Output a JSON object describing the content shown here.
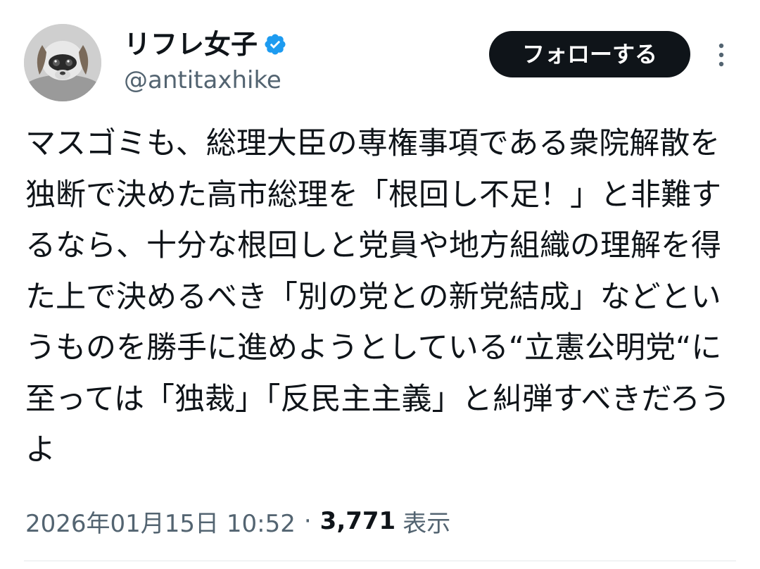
{
  "author": {
    "display_name": "リフレ女子",
    "handle": "@antitaxhike",
    "verified": true,
    "avatar_icon": "robot-dog-avatar"
  },
  "actions": {
    "follow_label": "フォローする",
    "more_icon": "more-vertical-icon"
  },
  "tweet": {
    "text": "マスゴミも、総理大臣の専権事項である衆院解散を独断で決めた高市総理を「根回し不足！」と非難するなら、十分な根回しと党員や地方組織の理解を得た上で決めるべき「別の党との新党結成」などというものを勝手に進めようとしている“立憲公明党“に至っては「独裁」「反民主主義」と糾弾すべきだろうよ"
  },
  "meta": {
    "timestamp": "2026年01月15日 10:52",
    "separator": "·",
    "views_count": "3,771",
    "views_label": "表示"
  },
  "colors": {
    "text_primary": "#0f1419",
    "text_secondary": "#536471",
    "verified_blue": "#1d9bf0",
    "button_bg": "#0f1419"
  }
}
